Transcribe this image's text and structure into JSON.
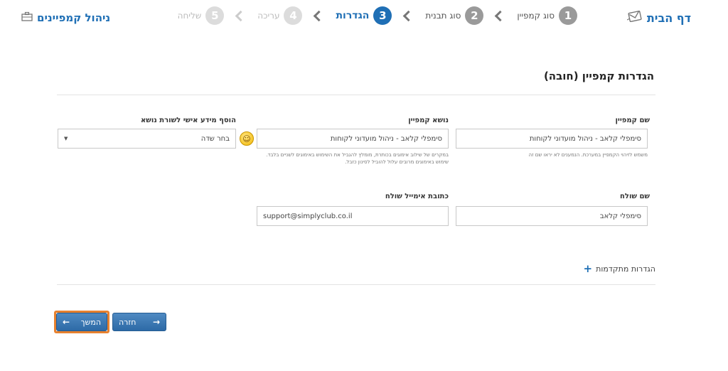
{
  "header": {
    "home_label": "דף הבית",
    "manage_label": "ניהול קמפיינים",
    "steps": [
      {
        "num": "1",
        "label": "סוג קמפיין",
        "state": "done"
      },
      {
        "num": "2",
        "label": "סוג תבנית",
        "state": "done"
      },
      {
        "num": "3",
        "label": "הגדרות",
        "state": "active"
      },
      {
        "num": "4",
        "label": "עריכה",
        "state": "disabled"
      },
      {
        "num": "5",
        "label": "שליחה",
        "state": "disabled"
      }
    ]
  },
  "section": {
    "title": "הגדרות קמפיין (חובה)"
  },
  "fields": {
    "campaign_name": {
      "label": "שם קמפיין",
      "value": "סימפלי קלאב - ניהול מועדוני לקוחות",
      "help": "משמש לזיהוי הקמפיין במערכת. הנמענים לא יראו שם זה"
    },
    "subject": {
      "label": "נושא קמפיין",
      "value": "סימפלי קלאב - ניהול מועדוני לקוחות",
      "help": "במקרים של שילוב אימוגים בכותרת, מומלץ להגביל את השימוש באימוגים לשניים בלבד. שימוש באימוגים מרובים עלול להוביל לסינון כזבל."
    },
    "personalize": {
      "label": "הוסף מידע אישי לשורת נושא",
      "value": "בחר שדה",
      "caret": "▼"
    },
    "sender_name": {
      "label": "שם שולח",
      "value": "סימפלי קלאב"
    },
    "sender_email": {
      "label": "כתובת אימייל שולח",
      "value": "support@simplyclub.co.il"
    }
  },
  "advanced": {
    "label": "הגדרות מתקדמות",
    "icon": "+"
  },
  "buttons": {
    "next_label": "המשך",
    "back_label": "חזרה",
    "next_arrow": "←",
    "back_arrow": "→"
  },
  "colors": {
    "accent": "#1f6fb5",
    "button": "#3a78b5",
    "focus_outline": "#e7812f"
  }
}
